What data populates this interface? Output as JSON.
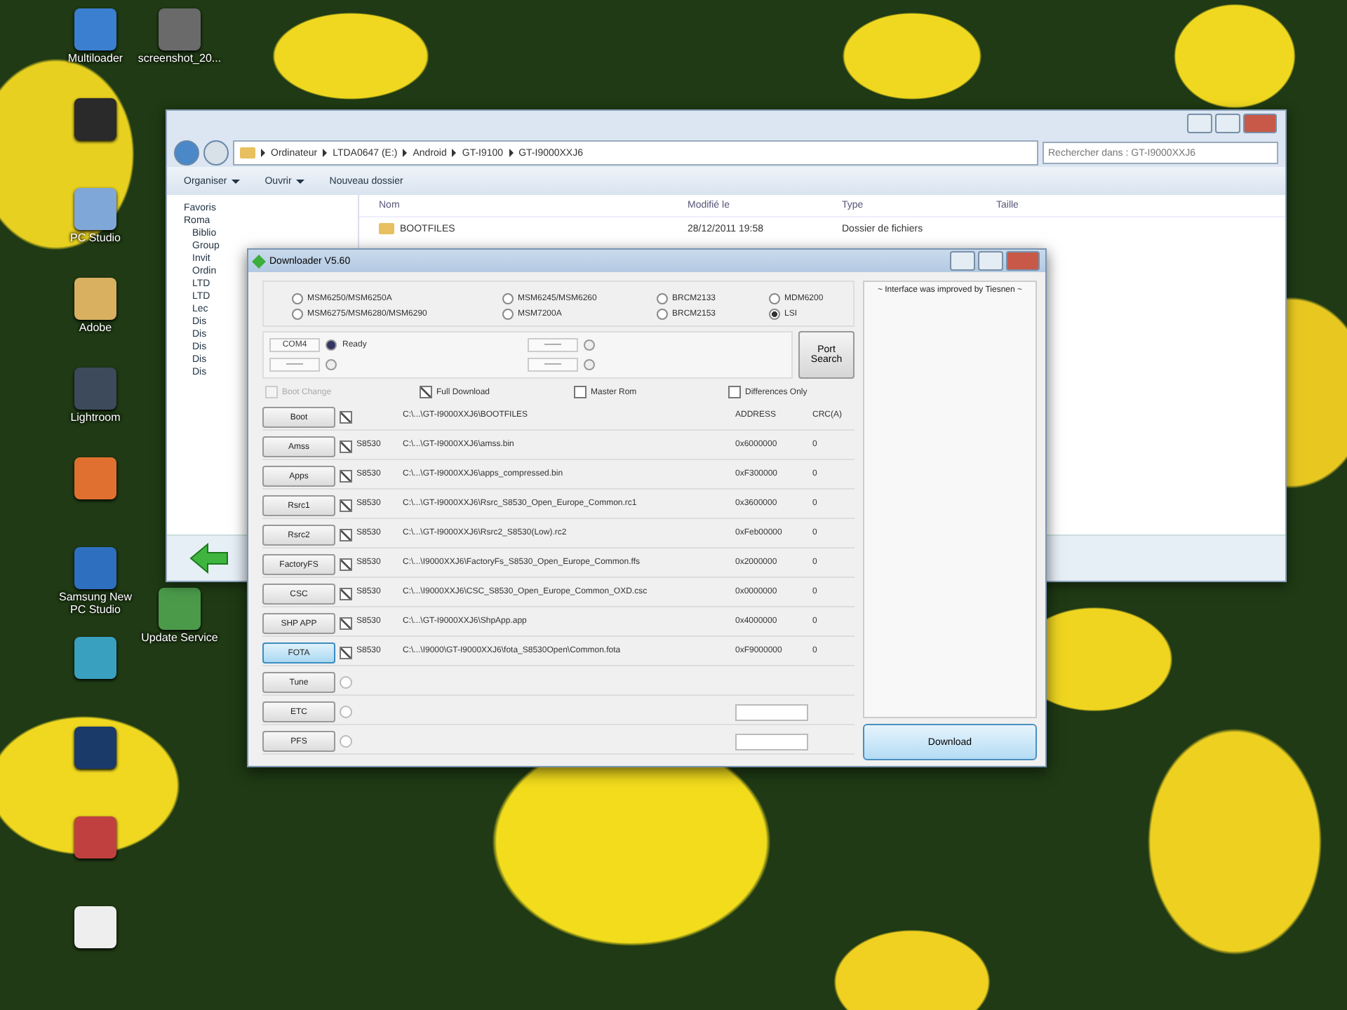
{
  "desktop": {
    "icons": [
      {
        "label": "Multiloader",
        "color": "#3a7fd0"
      },
      {
        "label": "screenshot_20...",
        "color": "#6a6a6a"
      },
      {
        "color": "#2a2a2a"
      },
      {
        "label": "PC Studio",
        "color": "#7fa8d8"
      },
      {
        "label": "Adobe",
        "color": "#d8b060"
      },
      {
        "label": "Lightroom",
        "color": "#3c4a5c"
      },
      {
        "color": "#e07030"
      },
      {
        "label": "Samsung New PC Studio",
        "color": "#2f6fc0"
      },
      {
        "label": "Update Service",
        "color": "#4a9a4a"
      },
      {
        "color": "#3aa0c0"
      },
      {
        "color": "#1a3a6a"
      },
      {
        "color": "#c04040"
      },
      {
        "color": "#eeeeee"
      }
    ]
  },
  "explorer": {
    "breadcrumb": [
      "Ordinateur",
      "LTDA0647 (E:)",
      "Android",
      "GT-I9100",
      "GT-I9000XXJ6"
    ],
    "search": {
      "placeholder": "Rechercher dans : GT-I9000XXJ6"
    },
    "toolbar": [
      {
        "label": "Organiser",
        "dropdown": true
      },
      {
        "label": "Ouvrir",
        "dropdown": true
      },
      {
        "label": "Nouveau dossier",
        "dropdown": false
      }
    ],
    "nav": [
      {
        "label": "Favoris"
      },
      {
        "label": "Roma",
        "children": [
          {
            "label": "Biblio"
          },
          {
            "label": "Group"
          },
          {
            "label": "Invit"
          },
          {
            "label": "Ordin"
          },
          {
            "label": "LTD"
          },
          {
            "label": "LTD"
          },
          {
            "label": "Lec"
          },
          {
            "label": "Dis"
          },
          {
            "label": "Dis"
          },
          {
            "label": "Dis"
          },
          {
            "label": "Dis"
          },
          {
            "label": "Dis"
          }
        ]
      }
    ],
    "columns": [
      "Nom",
      "Modifié le",
      "Type",
      "Taille"
    ],
    "rows": [
      {
        "name": "BOOTFILES",
        "modified": "28/12/2011 19:58",
        "type": "Dossier de fichiers",
        "size": ""
      }
    ]
  },
  "downloader": {
    "title": "Downloader V5.60",
    "chipsets": [
      {
        "label": "MSM6250/MSM6250A",
        "selected": false
      },
      {
        "label": "MSM6245/MSM6260",
        "selected": false
      },
      {
        "label": "BRCM2133",
        "selected": false
      },
      {
        "label": "MDM6200",
        "selected": false
      },
      {
        "label": "MSM6275/MSM6280/MSM6290",
        "selected": false
      },
      {
        "label": "MSM7200A",
        "selected": false
      },
      {
        "label": "BRCM2153",
        "selected": false
      },
      {
        "label": "LSI",
        "selected": true
      }
    ],
    "ports": [
      {
        "port": "COM4",
        "status": "Ready",
        "connected": true
      },
      {
        "port": "——",
        "connected": false
      },
      {
        "port": "——",
        "connected": false
      },
      {
        "port": "——",
        "connected": false
      }
    ],
    "port_search": "Port Search",
    "options": [
      {
        "label": "Boot Change",
        "checked": false,
        "disabled": true
      },
      {
        "label": "Full Download",
        "checked": true,
        "disabled": false
      },
      {
        "label": "Master Rom",
        "checked": false,
        "disabled": false
      },
      {
        "label": "Differences Only",
        "checked": false,
        "disabled": false
      }
    ],
    "files": [
      {
        "button": "Boot",
        "focused": false,
        "checked": true,
        "path": "C:\\...\\GT-I9000XXJ6\\BOOTFILES",
        "address": "ADDRESS",
        "crc": "CRC(A)"
      },
      {
        "button": "Amss",
        "focused": false,
        "checked": true,
        "chip": "S8530",
        "path": "C:\\...\\GT-I9000XXJ6\\amss.bin",
        "address": "0x6000000",
        "crc": "0"
      },
      {
        "button": "Apps",
        "focused": false,
        "checked": true,
        "chip": "S8530",
        "path": "C:\\...\\GT-I9000XXJ6\\apps_compressed.bin",
        "address": "0xF300000",
        "crc": "0"
      },
      {
        "button": "Rsrc1",
        "focused": false,
        "checked": true,
        "chip": "S8530",
        "path": "C:\\...\\GT-I9000XXJ6\\Rsrc_S8530_Open_Europe_Common.rc1",
        "address": "0x3600000",
        "crc": "0"
      },
      {
        "button": "Rsrc2",
        "focused": false,
        "checked": true,
        "chip": "S8530",
        "path": "C:\\...\\GT-I9000XXJ6\\Rsrc2_S8530(Low).rc2",
        "address": "0xFeb00000",
        "crc": "0"
      },
      {
        "button": "FactoryFS",
        "focused": false,
        "checked": true,
        "chip": "S8530",
        "path": "C:\\...\\I9000XXJ6\\FactoryFs_S8530_Open_Europe_Common.ffs",
        "address": "0x2000000",
        "crc": "0"
      },
      {
        "button": "CSC",
        "focused": false,
        "checked": true,
        "chip": "S8530",
        "path": "C:\\...\\I9000XXJ6\\CSC_S8530_Open_Europe_Common_OXD.csc",
        "address": "0x0000000",
        "crc": "0"
      },
      {
        "button": "SHP APP",
        "focused": false,
        "checked": true,
        "chip": "S8530",
        "path": "C:\\...\\GT-I9000XXJ6\\ShpApp.app",
        "address": "0x4000000",
        "crc": "0"
      },
      {
        "button": "FOTA",
        "focused": true,
        "checked": true,
        "chip": "S8530",
        "path": "C:\\...\\I9000\\GT-I9000XXJ6\\fota_S8530Open\\Common.fota",
        "address": "0xF9000000",
        "crc": "0"
      },
      {
        "button": "Tune",
        "focused": false,
        "checked": false
      },
      {
        "button": "ETC",
        "focused": false,
        "checked": false
      },
      {
        "button": "PFS",
        "focused": false,
        "checked": false
      }
    ],
    "log": [
      "~ Interface was improved by Tiesnen ~"
    ],
    "download_button": {
      "label": "Download",
      "hovered": true
    }
  }
}
